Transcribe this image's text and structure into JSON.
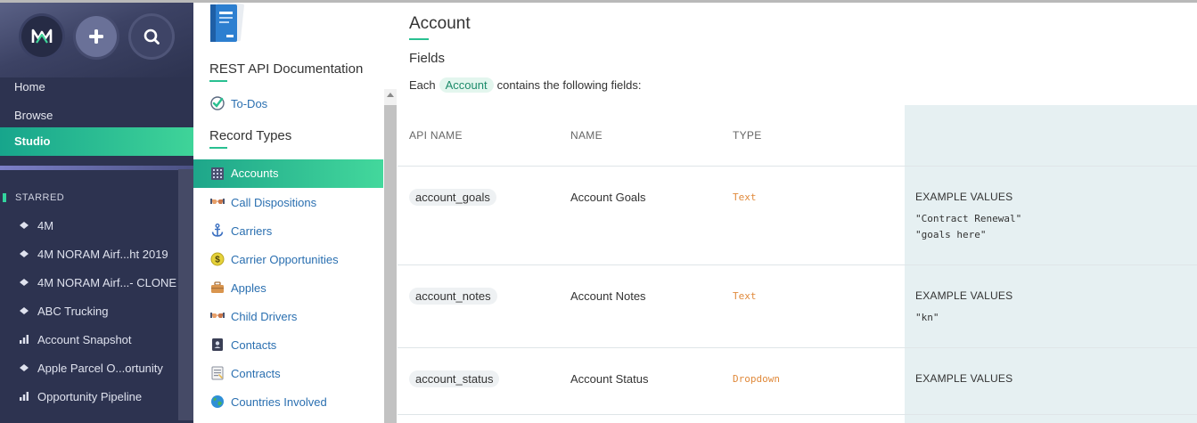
{
  "colors": {
    "accent": "#29c091",
    "nav_bg": "#2d3350",
    "link": "#2a6fb0",
    "type_text": "#e08a3c"
  },
  "nav": {
    "top_icons": [
      "logo-icon",
      "add-icon",
      "search-icon"
    ],
    "links": [
      "Home",
      "Browse",
      "Studio"
    ],
    "active": "Studio",
    "starred_label": "STARRED",
    "starred": [
      {
        "label": "4M",
        "icon": "diamond-icon"
      },
      {
        "label": "4M NORAM Airf...ht 2019",
        "icon": "diamond-icon"
      },
      {
        "label": "4M NORAM Airf...- CLONE",
        "icon": "diamond-icon"
      },
      {
        "label": "ABC Trucking",
        "icon": "diamond-icon"
      },
      {
        "label": "Account Snapshot",
        "icon": "bar-chart-icon"
      },
      {
        "label": "Apple Parcel O...ortunity",
        "icon": "diamond-icon"
      },
      {
        "label": "Opportunity Pipeline",
        "icon": "bar-chart-icon"
      }
    ]
  },
  "middle": {
    "doc_title": "REST API Documentation",
    "todos": "To-Dos",
    "record_types_title": "Record Types",
    "items": [
      {
        "label": "Accounts",
        "icon": "grid-icon",
        "active": true
      },
      {
        "label": "Call Dispositions",
        "icon": "handshake-icon"
      },
      {
        "label": "Carriers",
        "icon": "anchor-icon"
      },
      {
        "label": "Carrier Opportunities",
        "icon": "dollar-coin-icon"
      },
      {
        "label": "Apples",
        "icon": "briefcase-icon"
      },
      {
        "label": "Child Drivers",
        "icon": "handshake-icon"
      },
      {
        "label": "Contacts",
        "icon": "contact-book-icon"
      },
      {
        "label": "Contracts",
        "icon": "document-icon"
      },
      {
        "label": "Countries Involved",
        "icon": "globe-icon"
      }
    ]
  },
  "main": {
    "title": "Account",
    "fields_title": "Fields",
    "description_before": "Each",
    "description_pill": "Account",
    "description_after": "contains the following fields:",
    "headers": {
      "api_name": "API NAME",
      "name": "NAME",
      "type": "TYPE"
    },
    "rows": [
      {
        "api_name": "account_goals",
        "name": "Account Goals",
        "type": "Text",
        "example_label": "EXAMPLE VALUES",
        "examples": [
          "\"Contract Renewal\"",
          "\"goals here\""
        ]
      },
      {
        "api_name": "account_notes",
        "name": "Account Notes",
        "type": "Text",
        "example_label": "EXAMPLE VALUES",
        "examples": [
          "\"kn\""
        ]
      },
      {
        "api_name": "account_status",
        "name": "Account Status",
        "type": "Dropdown",
        "example_label": "EXAMPLE VALUES",
        "examples": []
      }
    ]
  }
}
